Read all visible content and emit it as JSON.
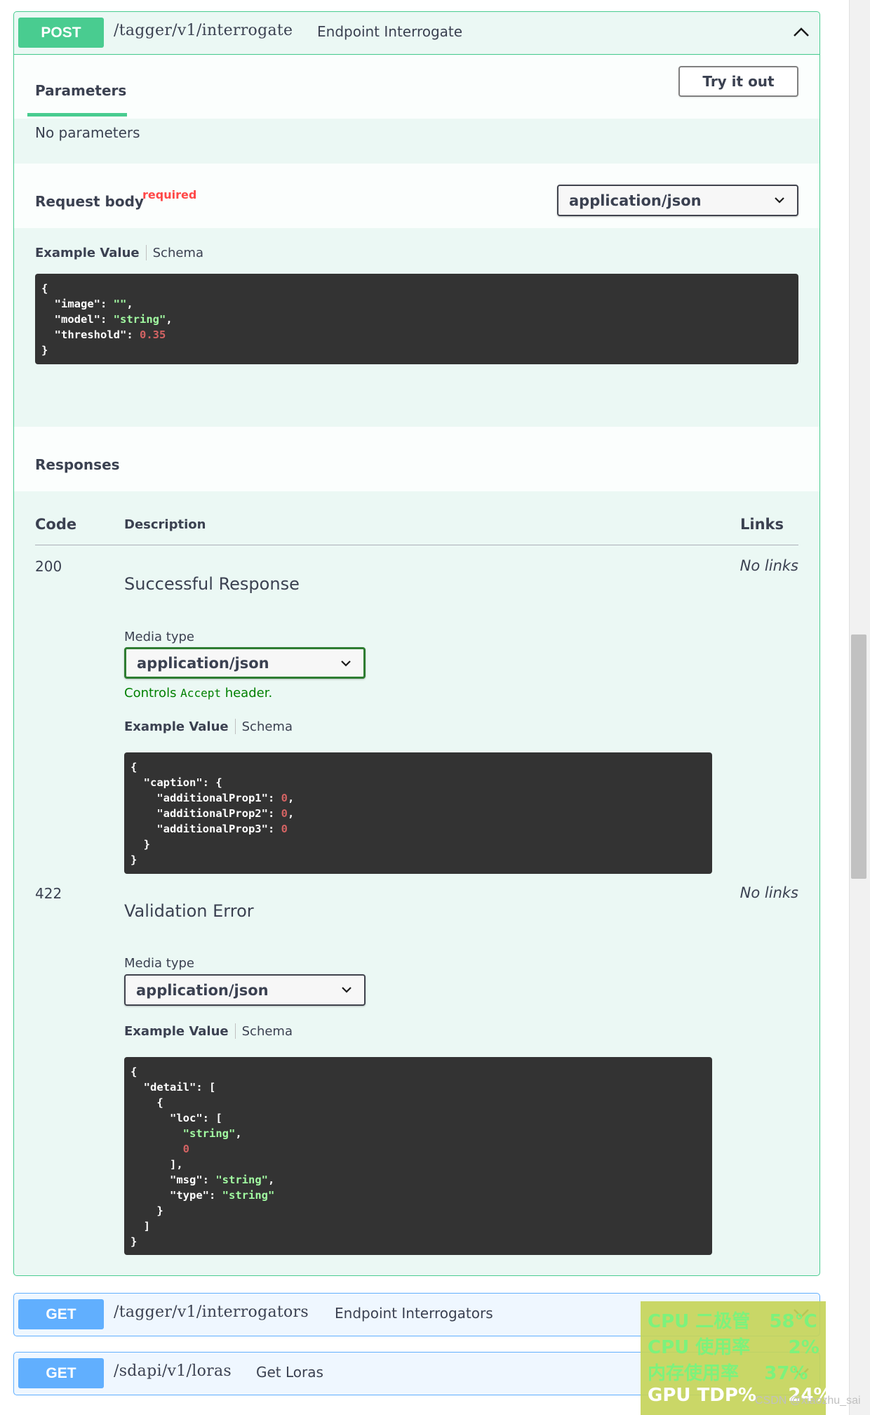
{
  "post_op": {
    "method": "POST",
    "path": "/tagger/v1/interrogate",
    "summary": "Endpoint Interrogate",
    "parameters_tab": "Parameters",
    "try_button": "Try it out",
    "no_params": "No parameters",
    "request_body_label": "Request body",
    "required_label": "required",
    "content_type": "application/json",
    "example_tab": "Example Value",
    "schema_tab": "Schema",
    "request_example": [
      {
        "t": "{"
      },
      {
        "indent": 1,
        "key": "image",
        "val": "\"\"",
        "kind": "s",
        "comma": true
      },
      {
        "indent": 1,
        "key": "model",
        "val": "\"string\"",
        "kind": "s",
        "comma": true
      },
      {
        "indent": 1,
        "key": "threshold",
        "val": "0.35",
        "kind": "n",
        "comma": false
      },
      {
        "t": "}"
      }
    ]
  },
  "responses": {
    "title": "Responses",
    "col_code": "Code",
    "col_description": "Description",
    "col_links": "Links",
    "media_type_label": "Media type",
    "controls_prefix": "Controls ",
    "controls_code": "Accept",
    "controls_suffix": " header.",
    "items": [
      {
        "code": "200",
        "description": "Successful Response",
        "links": "No links",
        "media_type": "application/json",
        "example_tab": "Example Value",
        "schema_tab": "Schema",
        "example_lines": [
          {
            "t": "{"
          },
          {
            "indent": 1,
            "key": "caption",
            "val": "{",
            "kind": "p",
            "comma": false
          },
          {
            "indent": 2,
            "key": "additionalProp1",
            "val": "0",
            "kind": "n",
            "comma": true
          },
          {
            "indent": 2,
            "key": "additionalProp2",
            "val": "0",
            "kind": "n",
            "comma": true
          },
          {
            "indent": 2,
            "key": "additionalProp3",
            "val": "0",
            "kind": "n",
            "comma": false
          },
          {
            "indent": 1,
            "t": "}"
          },
          {
            "t": "}"
          }
        ]
      },
      {
        "code": "422",
        "description": "Validation Error",
        "links": "No links",
        "media_type": "application/json",
        "example_tab": "Example Value",
        "schema_tab": "Schema",
        "example_lines": [
          {
            "t": "{"
          },
          {
            "indent": 1,
            "key": "detail",
            "val": "[",
            "kind": "p",
            "comma": false
          },
          {
            "indent": 2,
            "t": "{"
          },
          {
            "indent": 3,
            "key": "loc",
            "val": "[",
            "kind": "p",
            "comma": false
          },
          {
            "indent": 4,
            "val": "\"string\"",
            "kind": "s",
            "comma": true
          },
          {
            "indent": 4,
            "val": "0",
            "kind": "n",
            "comma": false
          },
          {
            "indent": 3,
            "t": "],"
          },
          {
            "indent": 3,
            "key": "msg",
            "val": "\"string\"",
            "kind": "s",
            "comma": true
          },
          {
            "indent": 3,
            "key": "type",
            "val": "\"string\"",
            "kind": "s",
            "comma": false
          },
          {
            "indent": 2,
            "t": "}"
          },
          {
            "indent": 1,
            "t": "]"
          },
          {
            "t": "}"
          }
        ]
      }
    ]
  },
  "get_ops": [
    {
      "method": "GET",
      "path": "/tagger/v1/interrogators",
      "summary": "Endpoint Interrogators"
    },
    {
      "method": "GET",
      "path": "/sdapi/v1/loras",
      "summary": "Get Loras"
    }
  ],
  "overlay": {
    "line1": "CPU 二极管   58°C",
    "line2": "CPU 使用率      2%",
    "line3": "内存使用率    37%",
    "line4": "GPU TDP%     24%"
  },
  "watermark": "CSDN @xiaozhu_sai",
  "colors": {
    "post": "#49cc90",
    "get": "#61affe",
    "required": "#ff4747",
    "code_bg": "#333333",
    "code_string": "#a2fca2",
    "code_number": "#d36363"
  },
  "icons": {
    "collapse": "chevron-up-icon",
    "expand": "chevron-down-icon",
    "select": "caret-down-icon"
  }
}
